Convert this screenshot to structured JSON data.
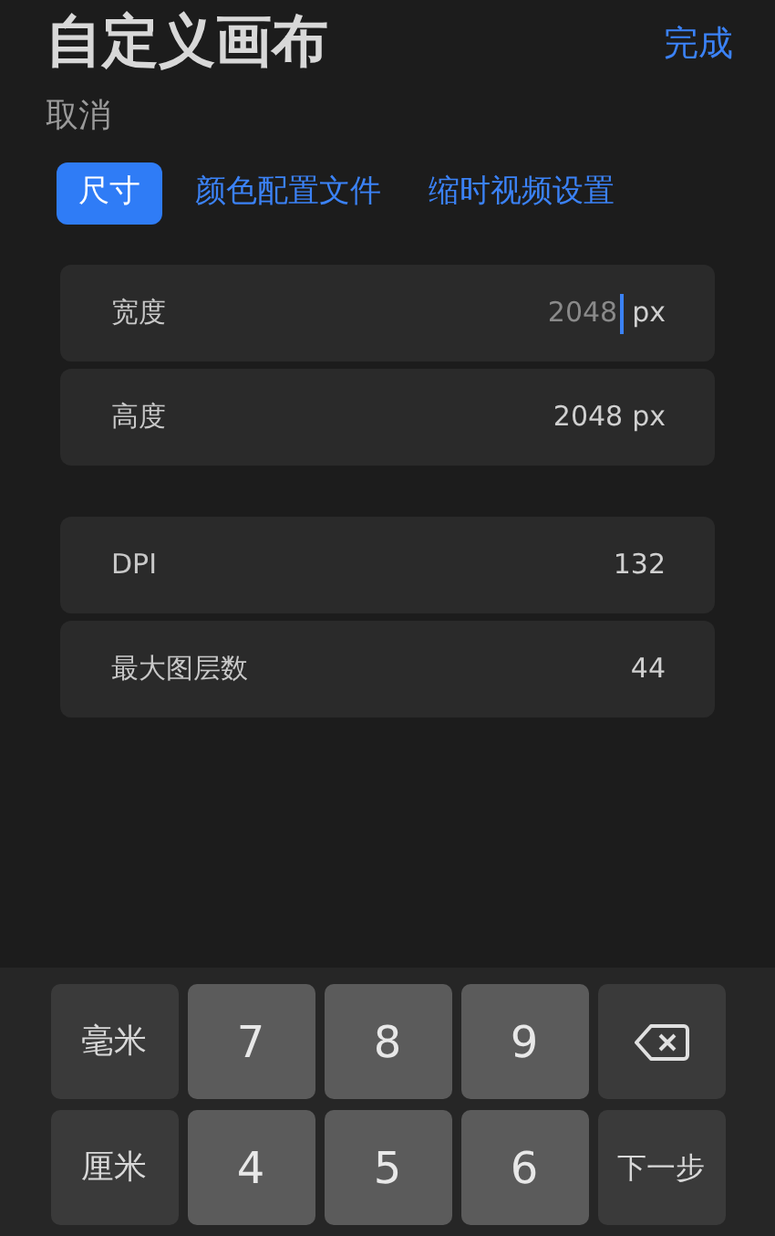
{
  "header": {
    "title": "自定义画布",
    "done": "完成",
    "cancel": "取消"
  },
  "tabs": [
    {
      "label": "尺寸",
      "selected": true
    },
    {
      "label": "颜色配置文件",
      "selected": false
    },
    {
      "label": "缩时视频设置",
      "selected": false
    }
  ],
  "groups": [
    [
      {
        "label": "宽度",
        "value": "2048",
        "unit": "px",
        "editing": true
      },
      {
        "label": "高度",
        "value": "2048",
        "unit": "px",
        "editing": false
      }
    ],
    [
      {
        "label": "DPI",
        "value": "132",
        "editing": false
      },
      {
        "label": "最大图层数",
        "value": "44",
        "editing": false
      }
    ]
  ],
  "keyboard": [
    [
      {
        "kind": "unit",
        "label": "毫米"
      },
      {
        "kind": "digit",
        "label": "7"
      },
      {
        "kind": "digit",
        "label": "8"
      },
      {
        "kind": "digit",
        "label": "9"
      },
      {
        "kind": "delete"
      }
    ],
    [
      {
        "kind": "unit",
        "label": "厘米"
      },
      {
        "kind": "digit",
        "label": "4"
      },
      {
        "kind": "digit",
        "label": "5"
      },
      {
        "kind": "digit",
        "label": "6"
      },
      {
        "kind": "action",
        "label": "下一步"
      }
    ]
  ]
}
